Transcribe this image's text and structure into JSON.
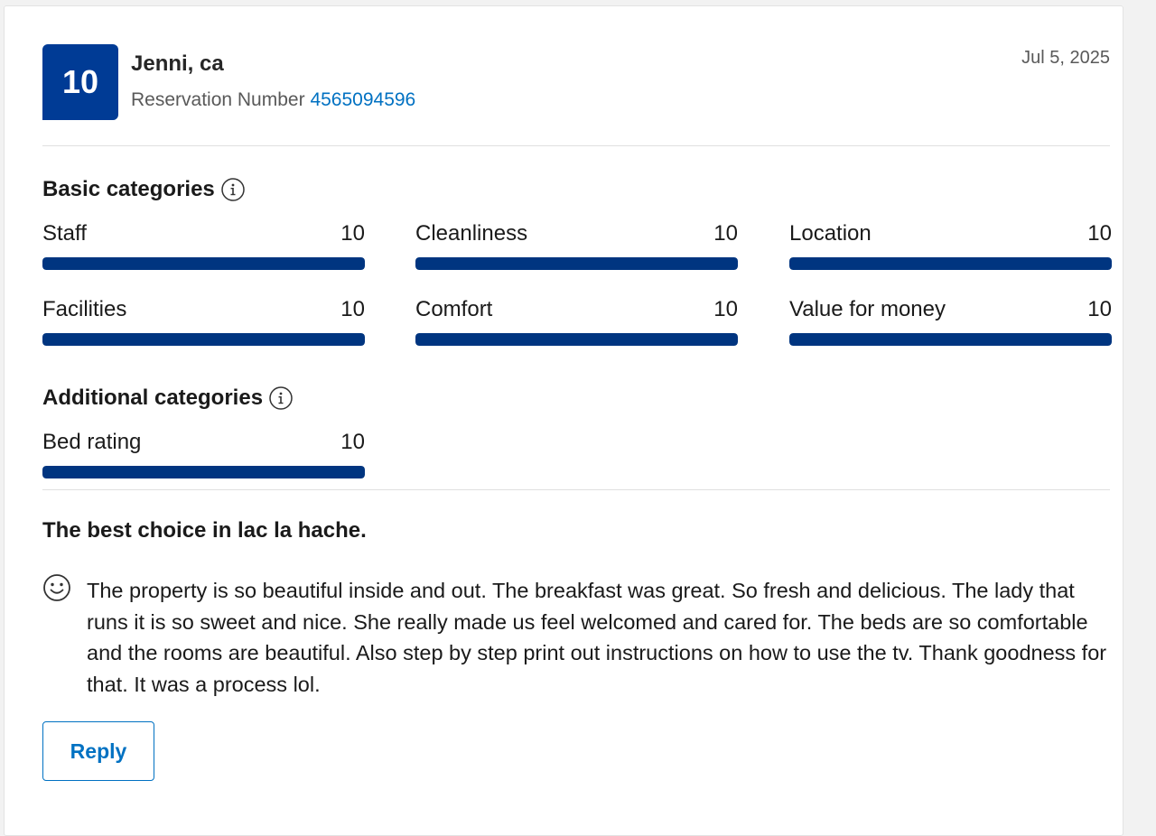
{
  "review": {
    "score": "10",
    "reviewer_name": "Jenni, ca",
    "reservation_label": "Reservation Number",
    "reservation_number": "4565094596",
    "date": "Jul 5, 2025"
  },
  "basic_categories": {
    "title": "Basic categories",
    "items": [
      {
        "label": "Staff",
        "score": "10",
        "fill": 1.0
      },
      {
        "label": "Cleanliness",
        "score": "10",
        "fill": 1.0
      },
      {
        "label": "Location",
        "score": "10",
        "fill": 1.0
      },
      {
        "label": "Facilities",
        "score": "10",
        "fill": 1.0
      },
      {
        "label": "Comfort",
        "score": "10",
        "fill": 1.0
      },
      {
        "label": "Value for money",
        "score": "10",
        "fill": 1.0
      }
    ]
  },
  "additional_categories": {
    "title": "Additional categories",
    "items": [
      {
        "label": "Bed rating",
        "score": "10",
        "fill": 1.0
      }
    ]
  },
  "review_body": {
    "title": "The best choice in lac la hache.",
    "positive_text": "The property is so beautiful inside and out. The breakfast was great. So fresh and delicious. The lady that runs it is so sweet and nice. She really made us feel welcomed and cared for. The beds are so comfortable and the rooms are beautiful. Also step by step print out instructions on how to use the tv. Thank goodness for that. It was a process lol."
  },
  "actions": {
    "reply_label": "Reply"
  },
  "colors": {
    "score_box": "#003b95",
    "bar_fill": "#003580",
    "link": "#0071c2"
  },
  "icons": {
    "info": "info-icon",
    "positive": "smile-icon"
  }
}
